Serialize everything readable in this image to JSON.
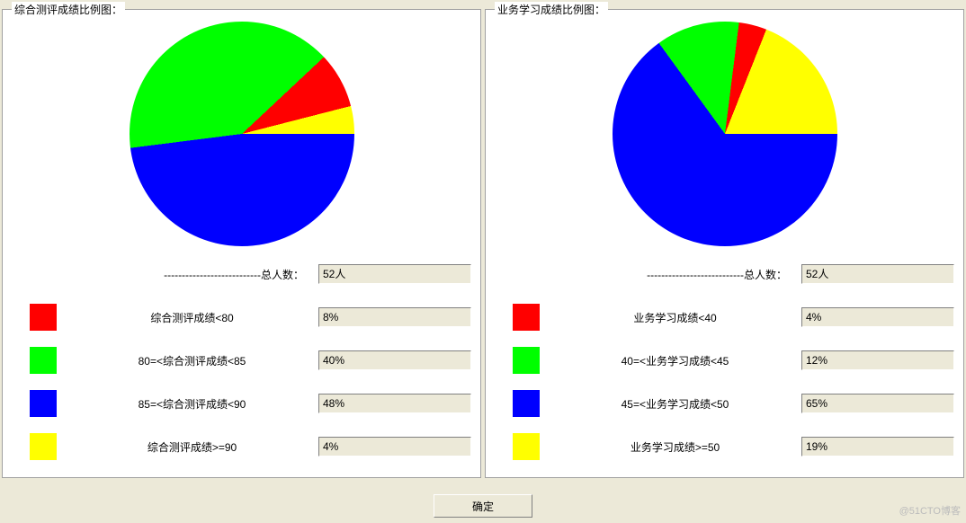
{
  "panels": {
    "left": {
      "title": "综合测评成绩比例图：",
      "total_dashes": "---------------------------",
      "total_label": "总人数：",
      "total_value": "52人",
      "rows": [
        {
          "color": "#ff0000",
          "label": "综合测评成绩<80",
          "value": "8%"
        },
        {
          "color": "#00ff00",
          "label": "80=<综合测评成绩<85",
          "value": "40%"
        },
        {
          "color": "#0000ff",
          "label": "85=<综合测评成绩<90",
          "value": "48%"
        },
        {
          "color": "#ffff00",
          "label": "综合测评成绩>=90",
          "value": "4%"
        }
      ]
    },
    "right": {
      "title": "业务学习成绩比例图：",
      "total_dashes": "---------------------------",
      "total_label": "总人数：",
      "total_value": "52人",
      "rows": [
        {
          "color": "#ff0000",
          "label": "业务学习成绩<40",
          "value": "4%"
        },
        {
          "color": "#00ff00",
          "label": "40=<业务学习成绩<45",
          "value": "12%"
        },
        {
          "color": "#0000ff",
          "label": "45=<业务学习成绩<50",
          "value": "65%"
        },
        {
          "color": "#ffff00",
          "label": "业务学习成绩>=50",
          "value": "19%"
        }
      ]
    }
  },
  "ok_button": "确定",
  "watermark": "@51CTO博客",
  "chart_data": [
    {
      "type": "pie",
      "title": "综合测评成绩比例图",
      "total": 52,
      "categories": [
        "综合测评成绩<80",
        "80=<综合测评成绩<85",
        "85=<综合测评成绩<90",
        "综合测评成绩>=90"
      ],
      "values": [
        8,
        40,
        48,
        4
      ],
      "colors": [
        "#ff0000",
        "#00ff00",
        "#0000ff",
        "#ffff00"
      ],
      "start_angle_deg": 0,
      "direction": "counterclockwise",
      "draw_order_indices": [
        3,
        0,
        1,
        2
      ]
    },
    {
      "type": "pie",
      "title": "业务学习成绩比例图",
      "total": 52,
      "categories": [
        "业务学习成绩<40",
        "40=<业务学习成绩<45",
        "45=<业务学习成绩<50",
        "业务学习成绩>=50"
      ],
      "values": [
        4,
        12,
        65,
        19
      ],
      "colors": [
        "#ff0000",
        "#00ff00",
        "#0000ff",
        "#ffff00"
      ],
      "start_angle_deg": 0,
      "direction": "counterclockwise",
      "draw_order_indices": [
        3,
        0,
        1,
        2
      ]
    }
  ]
}
